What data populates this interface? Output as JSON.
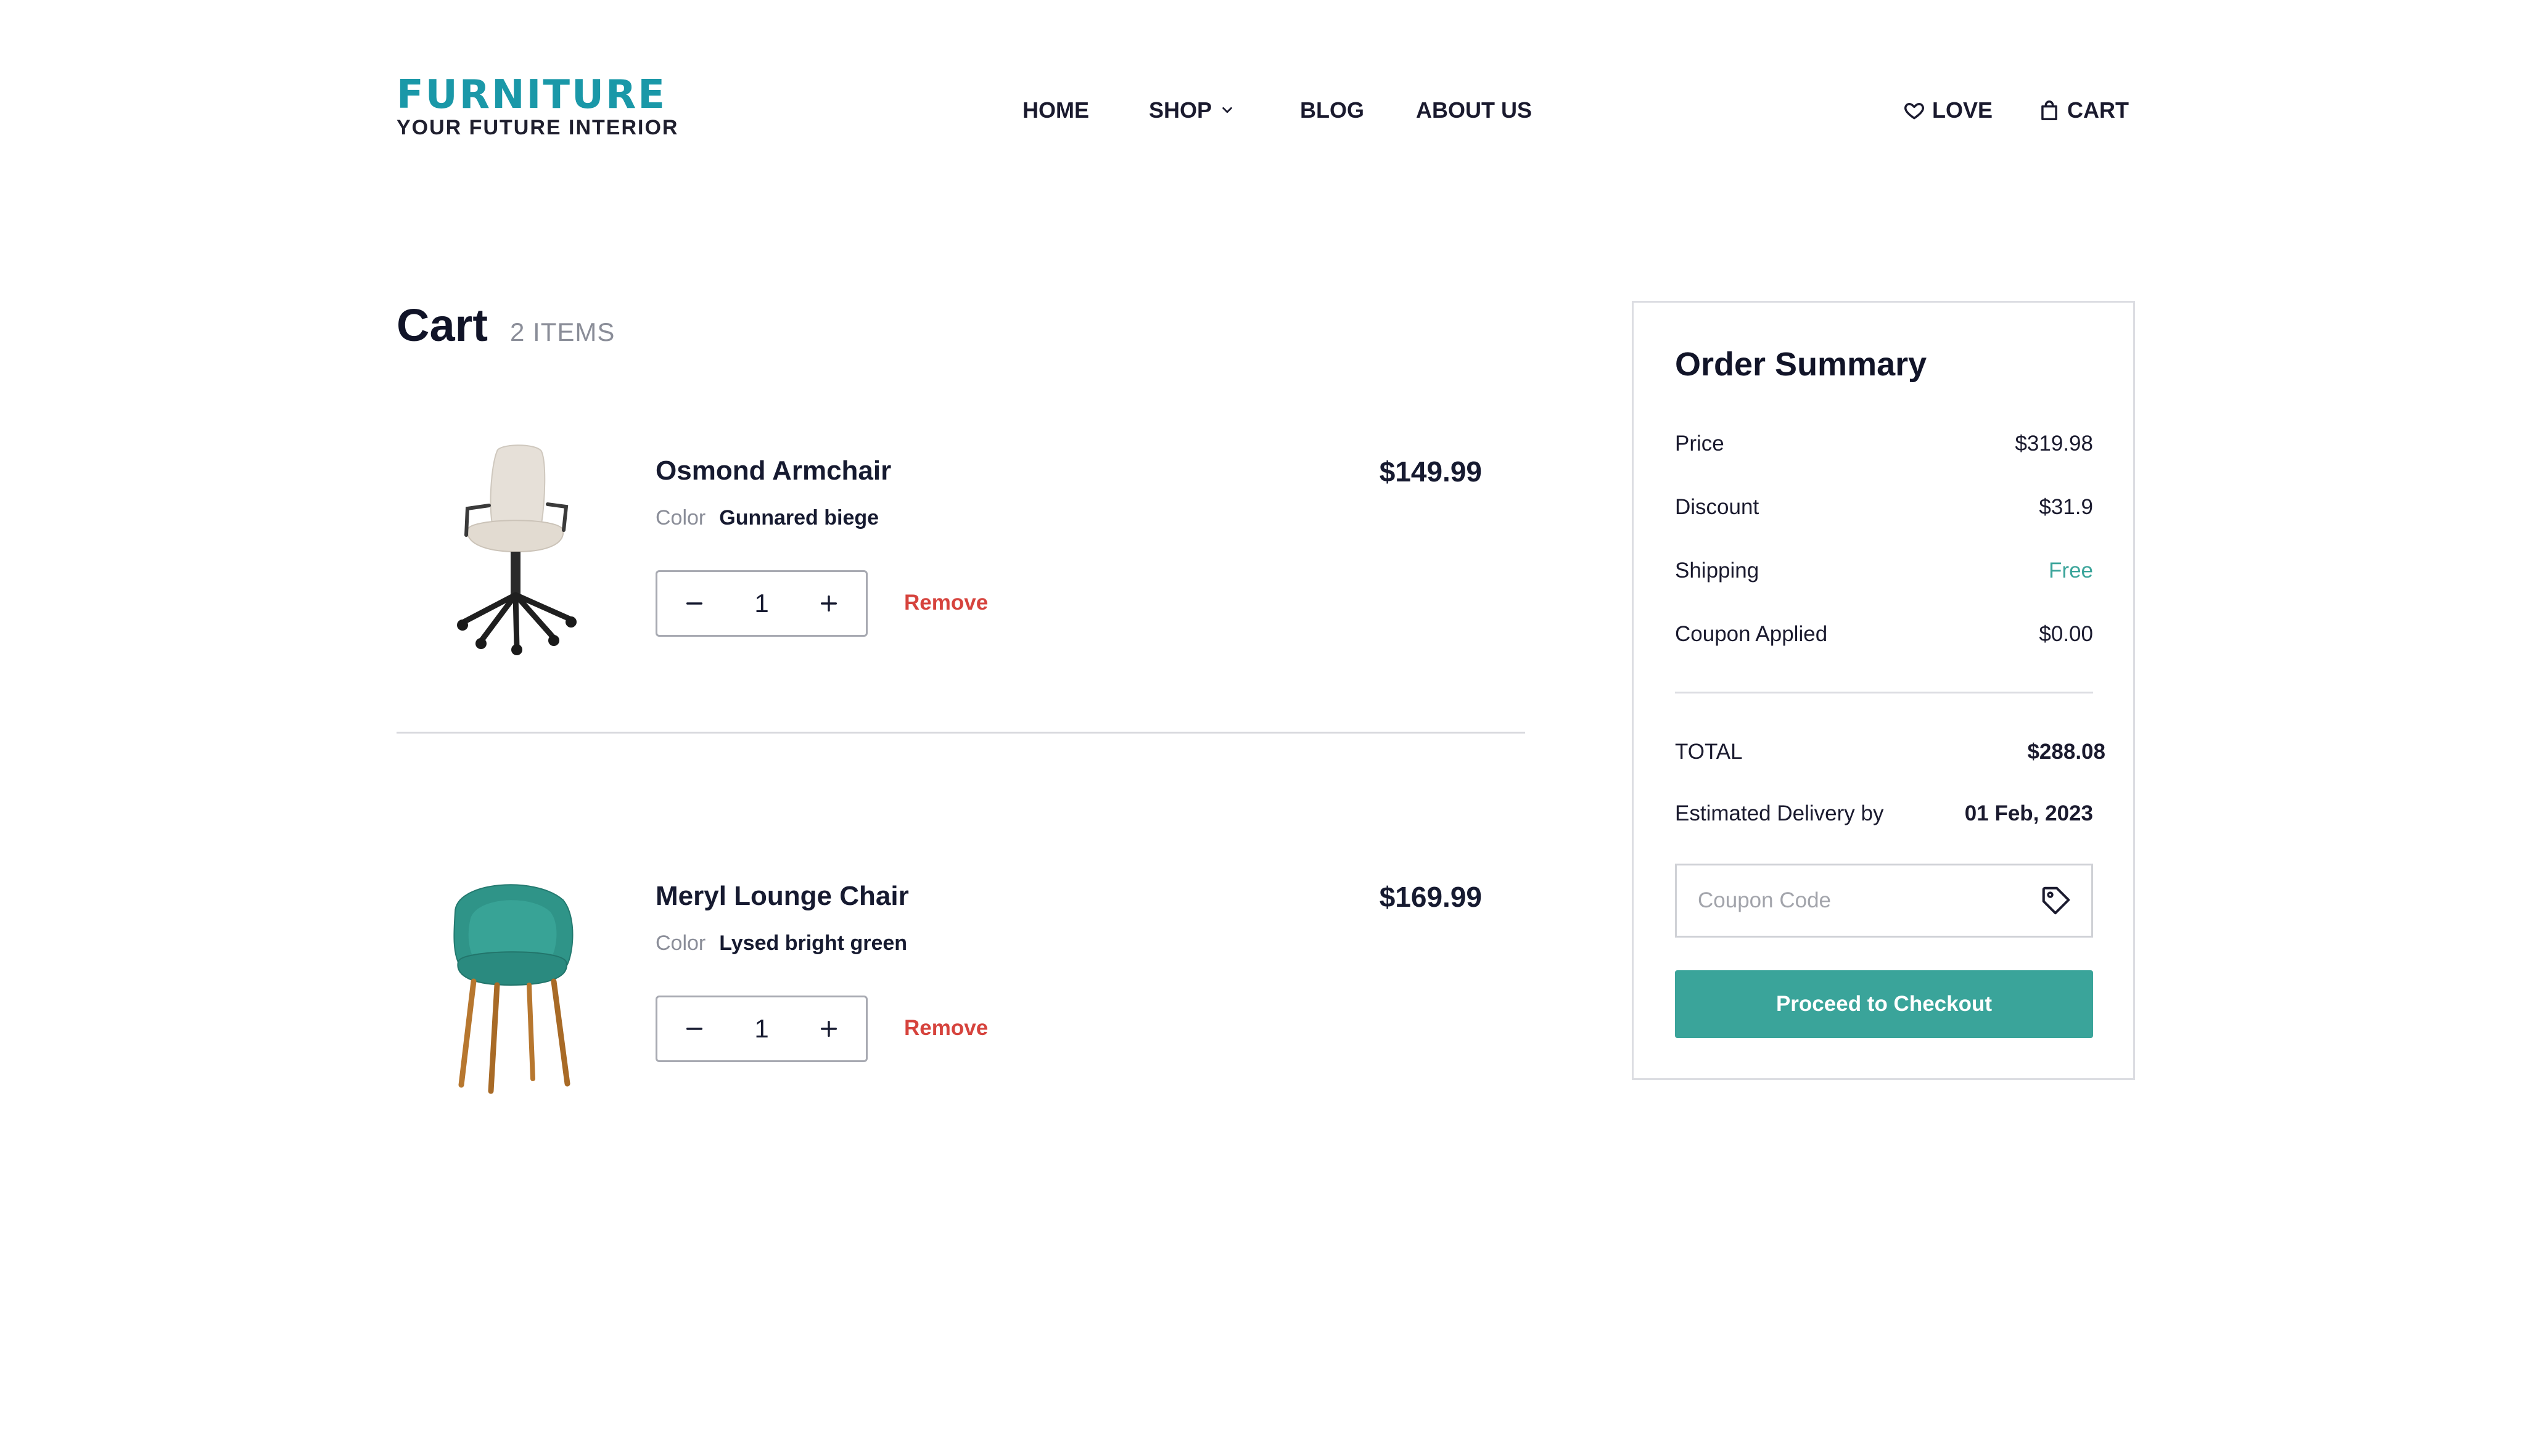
{
  "brand": {
    "name": "FURNITURE",
    "tagline": "YOUR FUTURE INTERIOR"
  },
  "nav": {
    "items": [
      {
        "label": "HOME"
      },
      {
        "label": "SHOP",
        "icon": "chevron-down-icon"
      },
      {
        "label": "BLOG"
      },
      {
        "label": "ABOUT US"
      }
    ],
    "love_label": "LOVE",
    "cart_label": "CART"
  },
  "cart": {
    "title": "Cart",
    "count_label": "2 ITEMS",
    "items": [
      {
        "name": "Osmond Armchair",
        "price": "$149.99",
        "color_label": "Color",
        "color_value": "Gunnared biege",
        "quantity": "1",
        "remove_label": "Remove",
        "image": "office-chair-image"
      },
      {
        "name": "Meryl Lounge Chair",
        "price": "$169.99",
        "color_label": "Color",
        "color_value": "Lysed bright green",
        "quantity": "1",
        "remove_label": "Remove",
        "image": "lounge-chair-image"
      }
    ]
  },
  "summary": {
    "title": "Order Summary",
    "rows": {
      "price": {
        "label": "Price",
        "value": "$319.98"
      },
      "discount": {
        "label": "Discount",
        "value": "$31.9"
      },
      "shipping": {
        "label": "Shipping",
        "value": "Free"
      },
      "coupon": {
        "label": "Coupon Applied",
        "value": "$0.00"
      },
      "total": {
        "label": "TOTAL",
        "value": "$288.08"
      },
      "delivery": {
        "label": "Estimated Delivery by",
        "value": "01 Feb, 2023"
      }
    },
    "coupon_placeholder": "Coupon Code",
    "checkout_label": "Proceed to Checkout"
  },
  "colors": {
    "brand": "#1a98a8",
    "accent": "#3aa49a",
    "remove": "#d6433d",
    "muted": "#8a8d98"
  }
}
